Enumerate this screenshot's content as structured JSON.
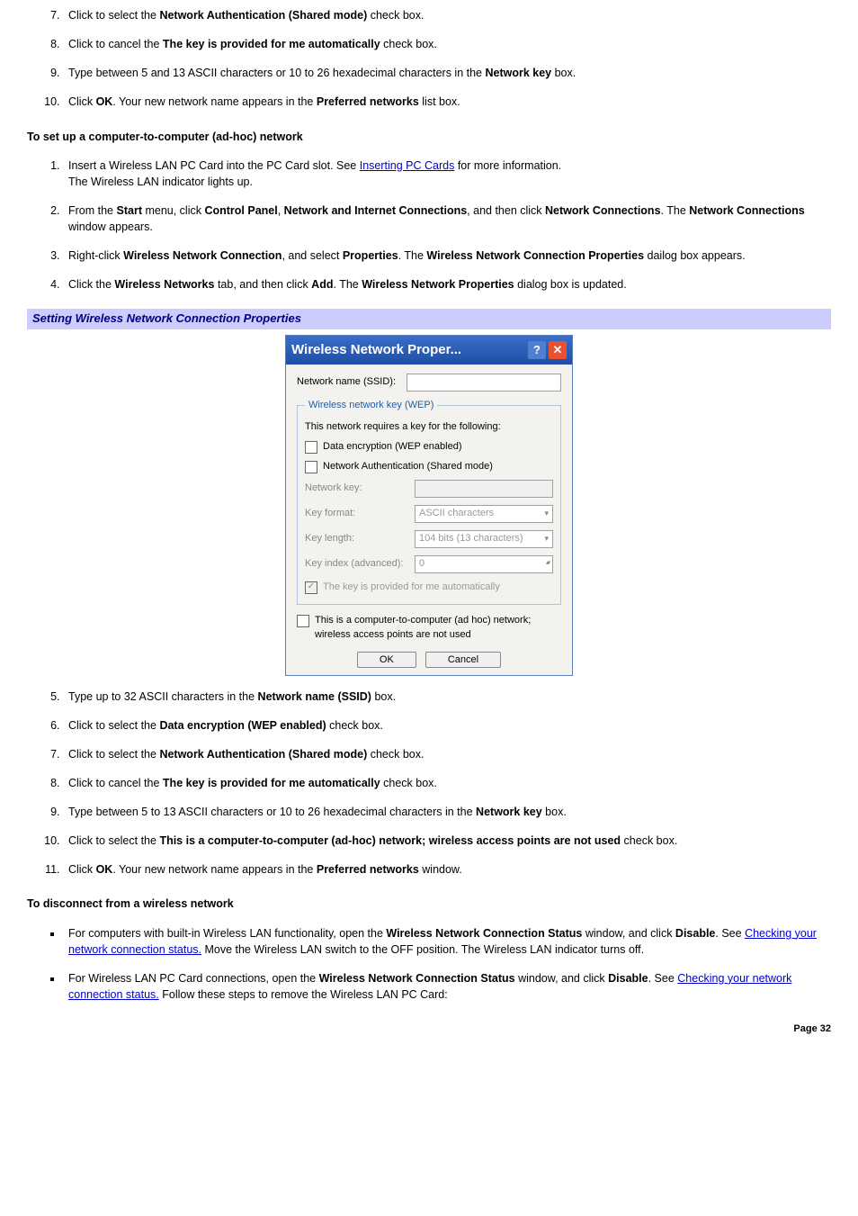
{
  "top_steps": {
    "s7": {
      "pre": "Click to select the ",
      "bold": "Network Authentication (Shared mode)",
      "post": " check box."
    },
    "s8": {
      "pre": "Click to cancel the ",
      "bold": "The key is provided for me automatically",
      "post": " check box."
    },
    "s9": {
      "pre": "Type between 5 and 13 ASCII characters or 10 to 26 hexadecimal characters in the ",
      "bold": "Network key",
      "post": " box."
    },
    "s10": {
      "pre": "Click ",
      "b1": "OK",
      "mid": ". Your new network name appears in the ",
      "b2": "Preferred networks",
      "post": " list box."
    }
  },
  "heading_adhoc": "To set up a computer-to-computer (ad-hoc) network",
  "adhoc_steps": {
    "s1": {
      "pre": "Insert a Wireless LAN PC Card into the PC Card slot. See ",
      "link": "Inserting PC Cards",
      "post1": " for more information.",
      "post2": "The Wireless LAN indicator lights up."
    },
    "s2": {
      "pre": "From the ",
      "b1": "Start",
      "t1": " menu, click ",
      "b2": "Control Panel",
      "t2": ", ",
      "b3": "Network and Internet Connections",
      "t3": ", and then click ",
      "b4": "Network Connections",
      "t4": ". The ",
      "b5": "Network Connections",
      "t5": " window appears."
    },
    "s3": {
      "pre": "Right-click ",
      "b1": "Wireless Network Connection",
      "t1": ", and select ",
      "b2": "Properties",
      "t2": ". The ",
      "b3": "Wireless Network Connection Properties",
      "t3": " dailog box appears."
    },
    "s4": {
      "pre": "Click the ",
      "b1": "Wireless Networks",
      "t1": " tab, and then click ",
      "b2": "Add",
      "t2": ". The ",
      "b3": "Wireless Network Properties",
      "t3": " dialog box is updated."
    }
  },
  "caption": "Setting Wireless Network Connection Properties",
  "dialog": {
    "title": "Wireless Network Proper...",
    "ssid_label": "Network name (SSID):",
    "fieldset_legend": "Wireless network key (WEP)",
    "requires_text": "This network requires a key for the following:",
    "chk_wep": "Data encryption (WEP enabled)",
    "chk_auth": "Network Authentication (Shared mode)",
    "lbl_key": "Network key:",
    "lbl_format": "Key format:",
    "val_format": "ASCII characters",
    "lbl_length": "Key length:",
    "val_length": "104 bits (13 characters)",
    "lbl_index": "Key index (advanced):",
    "val_index": "0",
    "chk_auto": "The key is provided for me automatically",
    "chk_adhoc": "This is a computer-to-computer (ad hoc) network; wireless access points are not used",
    "btn_ok": "OK",
    "btn_cancel": "Cancel"
  },
  "lower_steps": {
    "s5": {
      "pre": "Type up to 32 ASCII characters in the ",
      "bold": "Network name (SSID)",
      "post": " box."
    },
    "s6": {
      "pre": "Click to select the ",
      "bold": "Data encryption (WEP enabled)",
      "post": " check box."
    },
    "s7": {
      "pre": "Click to select the ",
      "bold": "Network Authentication (Shared mode)",
      "post": " check box."
    },
    "s8": {
      "pre": "Click to cancel the ",
      "bold": "The key is provided for me automatically",
      "post": " check box."
    },
    "s9": {
      "pre": "Type between 5 to 13 ASCII characters or 10 to 26 hexadecimal characters in the ",
      "bold": "Network key",
      "post": " box."
    },
    "s10": {
      "pre": "Click to select the ",
      "bold": "This is a computer-to-computer (ad-hoc) network; wireless access points are not used",
      "post": " check box."
    },
    "s11": {
      "pre": "Click ",
      "b1": "OK",
      "mid": ". Your new network name appears in the ",
      "b2": "Preferred networks",
      "post": " window."
    }
  },
  "heading_disconnect": "To disconnect from a wireless network",
  "disc": {
    "b1": {
      "pre": "For computers with built-in Wireless LAN functionality, open the ",
      "bB": "Wireless Network Connection Status",
      "t1": " window, and click ",
      "bC": "Disable",
      "t2": ". See ",
      "link": "Checking your network connection status.",
      "t3": " Move the Wireless LAN switch to the OFF position. The Wireless LAN indicator turns off."
    },
    "b2": {
      "pre": "For Wireless LAN PC Card connections, open the ",
      "bB": "Wireless Network Connection Status",
      "t1": " window, and click ",
      "bC": "Disable",
      "t2": ". See ",
      "link": "Checking your network connection status.",
      "t3": " Follow these steps to remove the Wireless LAN PC Card:"
    }
  },
  "page_num": "Page 32"
}
